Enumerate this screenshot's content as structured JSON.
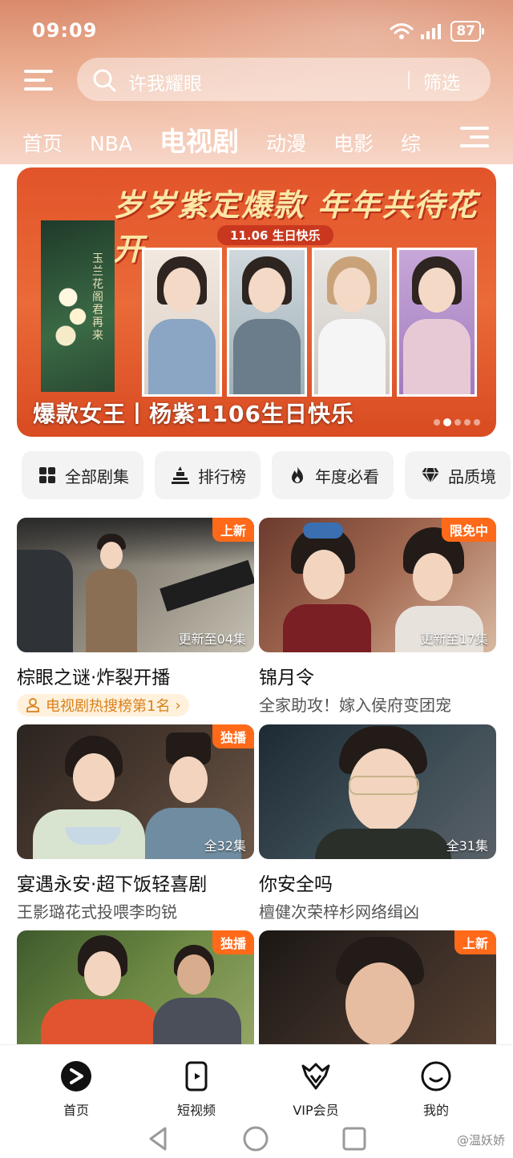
{
  "status": {
    "time": "09:09",
    "battery": "87"
  },
  "search": {
    "placeholder": "许我耀眼",
    "filter_label": "筛选"
  },
  "tabs": [
    {
      "label": "首页"
    },
    {
      "label": "NBA"
    },
    {
      "label": "电视剧",
      "active": true
    },
    {
      "label": "动漫"
    },
    {
      "label": "电影"
    },
    {
      "label": "综"
    }
  ],
  "banner": {
    "slogan": "岁岁紫定爆款 年年共待花开",
    "date_tag": "11.06 生日快乐",
    "poster_title": "玉兰花阁君再来",
    "caption": "爆款女王丨杨紫1106生日快乐",
    "page_count": 5,
    "active_page": 2
  },
  "categories": [
    {
      "label": "全部剧集",
      "icon": "grid-icon"
    },
    {
      "label": "排行榜",
      "icon": "podium-icon"
    },
    {
      "label": "年度必看",
      "icon": "fire-icon"
    },
    {
      "label": "品质境",
      "icon": "diamond-icon"
    }
  ],
  "cards": [
    {
      "badge": "上新",
      "episodes": "更新至04集",
      "title": "棕眼之谜·炸裂开播",
      "rank": "电视剧热搜榜第1名"
    },
    {
      "badge": "限免中",
      "episodes": "更新至17集",
      "title": "锦月令",
      "subtitle": "全家助攻！嫁入侯府变团宠"
    },
    {
      "badge": "独播",
      "episodes": "全32集",
      "title": "宴遇永安·超下饭轻喜剧",
      "subtitle": "王影璐花式投喂李昀锐"
    },
    {
      "badge": "",
      "episodes": "全31集",
      "title": "你安全吗",
      "subtitle": "檀健次荣梓杉网络缉凶"
    },
    {
      "badge": "独播",
      "episodes": "",
      "title": "",
      "subtitle": ""
    },
    {
      "badge": "上新",
      "episodes": "",
      "title": "",
      "subtitle": ""
    }
  ],
  "bottom_nav": [
    {
      "label": "首页",
      "icon": "play-logo-icon",
      "active": true
    },
    {
      "label": "短视频",
      "icon": "short-video-icon"
    },
    {
      "label": "VIP会员",
      "icon": "vip-crown-icon"
    },
    {
      "label": "我的",
      "icon": "smiley-icon"
    }
  ],
  "watermark": "@温妖娇",
  "colors": {
    "accent": "#ff6a1a",
    "banner": "#e2542a",
    "header_top": "#d98a6c"
  }
}
